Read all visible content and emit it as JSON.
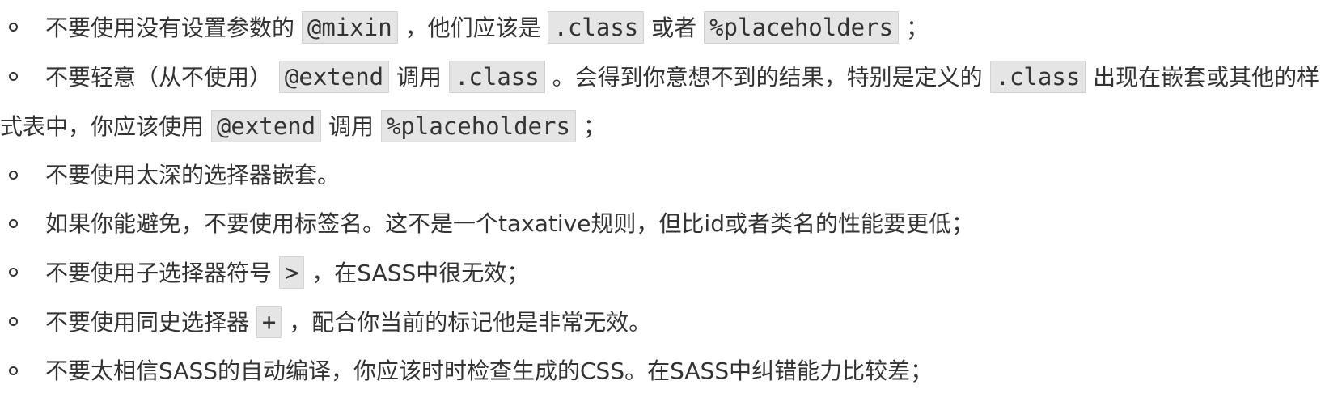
{
  "items": [
    {
      "segments": [
        {
          "t": "text",
          "v": "不要使用没有设置参数的 "
        },
        {
          "t": "code",
          "v": "@mixin"
        },
        {
          "t": "text",
          "v": " ，他们应该是 "
        },
        {
          "t": "code",
          "v": ".class"
        },
        {
          "t": "text",
          "v": " 或者 "
        },
        {
          "t": "code",
          "v": "%placeholders"
        },
        {
          "t": "text",
          "v": " ；"
        }
      ]
    },
    {
      "segments": [
        {
          "t": "text",
          "v": "不要轻意（从不使用） "
        },
        {
          "t": "code",
          "v": "@extend"
        },
        {
          "t": "text",
          "v": " 调用 "
        },
        {
          "t": "code",
          "v": ".class"
        },
        {
          "t": "text",
          "v": " 。会得到你意想不到的结果，特别是定义的 "
        },
        {
          "t": "code",
          "v": ".class"
        },
        {
          "t": "text",
          "v": " 出现在嵌套或其他的样式表中，你应该使用 "
        },
        {
          "t": "code",
          "v": "@extend"
        },
        {
          "t": "text",
          "v": " 调用 "
        },
        {
          "t": "code",
          "v": "%placeholders"
        },
        {
          "t": "text",
          "v": " ；"
        }
      ]
    },
    {
      "segments": [
        {
          "t": "text",
          "v": "不要使用太深的选择器嵌套。"
        }
      ]
    },
    {
      "segments": [
        {
          "t": "text",
          "v": "如果你能避免，不要使用标签名。这不是一个taxative规则，但比id或者类名的性能要更低；"
        }
      ]
    },
    {
      "segments": [
        {
          "t": "text",
          "v": "不要使用子选择器符号 "
        },
        {
          "t": "code",
          "v": ">"
        },
        {
          "t": "text",
          "v": " ，在SASS中很无效；"
        }
      ]
    },
    {
      "segments": [
        {
          "t": "text",
          "v": "不要使用同史选择器 "
        },
        {
          "t": "code",
          "v": "+"
        },
        {
          "t": "text",
          "v": " ，配合你当前的标记他是非常无效。"
        }
      ]
    },
    {
      "segments": [
        {
          "t": "text",
          "v": "不要太相信SASS的自动编译，你应该时时检查生成的CSS。在SASS中纠错能力比较差；"
        }
      ]
    }
  ]
}
